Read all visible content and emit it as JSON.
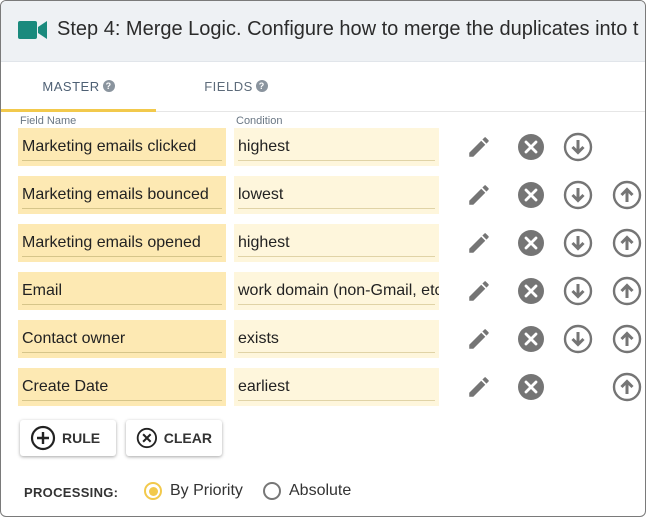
{
  "header": {
    "title": "Step 4: Merge Logic. Configure how to merge the duplicates into t",
    "icon": "video-camera-icon",
    "icon_color": "#1a8a7d"
  },
  "tabs": [
    {
      "label": "MASTER",
      "active": true
    },
    {
      "label": "FIELDS",
      "active": false
    }
  ],
  "columns": {
    "field_name": "Field Name",
    "condition": "Condition"
  },
  "rules": [
    {
      "field": "Marketing emails clicked",
      "condition": "highest",
      "move_down": true,
      "move_up": false
    },
    {
      "field": "Marketing emails bounced",
      "condition": "lowest",
      "move_down": true,
      "move_up": true
    },
    {
      "field": "Marketing emails opened",
      "condition": "highest",
      "move_down": true,
      "move_up": true
    },
    {
      "field": "Email",
      "condition": "work domain (non-Gmail, etc",
      "move_down": true,
      "move_up": true
    },
    {
      "field": "Contact owner",
      "condition": "exists",
      "move_down": true,
      "move_up": true
    },
    {
      "field": "Create Date",
      "condition": "earliest",
      "move_down": false,
      "move_up": true
    }
  ],
  "buttons": {
    "rule": "RULE",
    "clear": "CLEAR"
  },
  "processing": {
    "label": "PROCESSING:",
    "options": [
      {
        "label": "By Priority",
        "selected": true
      },
      {
        "label": "Absolute",
        "selected": false
      }
    ]
  },
  "colors": {
    "accent": "#f2c94c",
    "icon_gray": "#757575"
  }
}
